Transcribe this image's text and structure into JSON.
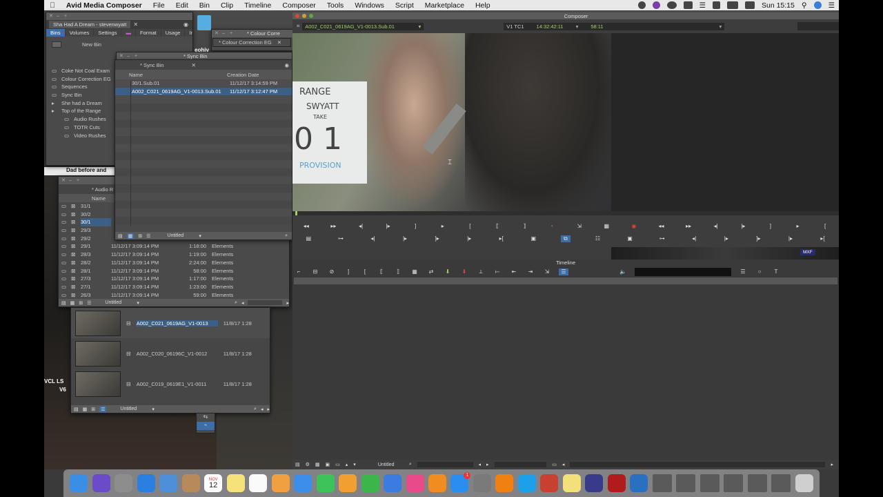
{
  "menubar": {
    "apple": "",
    "app_name": "Avid Media Composer",
    "items": [
      "File",
      "Edit",
      "Bin",
      "Clip",
      "Timeline",
      "Composer",
      "Tools",
      "Windows",
      "Script",
      "Marketplace",
      "Help"
    ],
    "clock": "Sun 15:15"
  },
  "project_window": {
    "title": "Sha Had A Dream - stevenwyatt",
    "tabs": [
      "Bins",
      "Volumes",
      "Settings",
      "Format",
      "Usage",
      "Info"
    ],
    "new_bin": "New Bin",
    "bins": [
      {
        "label": "Coke Not Coal Exam",
        "indent": 0
      },
      {
        "label": "Colour Correction EG",
        "indent": 0
      },
      {
        "label": "Sequences",
        "indent": 0
      },
      {
        "label": "Sync Bin",
        "indent": 0
      },
      {
        "label": "She had a Dream",
        "indent": 0,
        "folder": true
      },
      {
        "label": "Top of the Range",
        "indent": 0,
        "folder": true
      },
      {
        "label": "Audio Rushes",
        "indent": 1
      },
      {
        "label": "TOTR Cuts",
        "indent": 1
      },
      {
        "label": "Video Rushes",
        "indent": 1
      }
    ]
  },
  "colour_correction_tab": "* Colour Correction EG",
  "colour_corre_back": "* Colour Corre",
  "sync_bin": {
    "title": "* Sync Bin",
    "back_title": "* Sync Bin",
    "headers": [
      "Name",
      "Creation Date"
    ],
    "rows": [
      {
        "name": "30/1.Sub.01",
        "date": "11/12/17 3:14:59 PM",
        "selected": false
      },
      {
        "name": "A002_C021_0619AG_V1-0013.Sub.01",
        "date": "11/12/17 3:12:47 PM",
        "selected": true
      }
    ],
    "view": "Untitled"
  },
  "audio_bin": {
    "title": "* Audio R",
    "header": "Name",
    "rows": [
      {
        "name": "31/1",
        "date": "",
        "dur": "",
        "tracks": "",
        "selected": false
      },
      {
        "name": "30/2",
        "date": "",
        "dur": "",
        "tracks": "",
        "selected": false
      },
      {
        "name": "30/1",
        "date": "",
        "dur": "",
        "tracks": "",
        "selected": true
      },
      {
        "name": "29/3",
        "date": "",
        "dur": "",
        "tracks": "",
        "selected": false
      },
      {
        "name": "29/2",
        "date": "",
        "dur": "",
        "tracks": "",
        "selected": false
      },
      {
        "name": "29/1",
        "date": "11/12/17 3:09:14 PM",
        "dur": "1:18:00",
        "tracks": "Elements",
        "selected": false
      },
      {
        "name": "28/3",
        "date": "11/12/17 3:09:14 PM",
        "dur": "1:19:00",
        "tracks": "Elements",
        "selected": false
      },
      {
        "name": "28/2",
        "date": "11/12/17 3:09:14 PM",
        "dur": "2:24:00",
        "tracks": "Elements",
        "selected": false
      },
      {
        "name": "28/1",
        "date": "11/12/17 3:09:14 PM",
        "dur": "58:00",
        "tracks": "Elements",
        "selected": false
      },
      {
        "name": "27/3",
        "date": "11/12/17 3:09:14 PM",
        "dur": "1:17:00",
        "tracks": "Elements",
        "selected": false
      },
      {
        "name": "27/1",
        "date": "11/12/17 3:09:14 PM",
        "dur": "1:23:00",
        "tracks": "Elements",
        "selected": false
      },
      {
        "name": "26/3",
        "date": "11/12/17 3:09:14 PM",
        "dur": "59:00",
        "tracks": "Elements",
        "selected": false
      }
    ],
    "view": "Untitled"
  },
  "behind_window_title": "Dad before and",
  "behind_window_text_2": "eohiv",
  "video_bin": {
    "items": [
      {
        "name": "A002_C021_0619AG_V1-0013",
        "date": "11/8/17 1:28"
      },
      {
        "name": "A002_C020_06196C_V1-0012",
        "date": "11/8/17 1:28"
      },
      {
        "name": "A002_C019_0619E1_V1-0011",
        "date": "11/8/17 1:28"
      }
    ],
    "view": "Untitled"
  },
  "vcl_text": "VCL LS",
  "v6_text": "V6",
  "composer": {
    "title": "Composer",
    "clip_name": "A002_C021_0619AG_V1-0013.Sub.01",
    "tc_label": "V1  TC1",
    "timecode": "14:32:42:11",
    "duration": "58:11",
    "slate_lines": [
      "RANGE",
      "SWYATT",
      "TAKE",
      "0  1",
      "PROVISION"
    ]
  },
  "timeline": {
    "title": "Timeline",
    "view": "Untitled"
  },
  "mxf_badge": "MXF",
  "dock": {
    "calendar_month": "NOV",
    "calendar_day": "12",
    "badge_appstore": "1",
    "icons": [
      "finder-icon",
      "siri-icon",
      "launchpad-icon",
      "safari-icon",
      "preview-icon",
      "contacts-icon",
      "calendar-icon",
      "notes-icon",
      "reminders-icon",
      "photos-icon",
      "mail-icon",
      "messages-icon",
      "pages-icon",
      "numbers-icon",
      "keynote-icon",
      "itunes-icon",
      "ibooks-icon",
      "appstore-icon",
      "system-preferences-icon",
      "vlc-icon",
      "skype-icon",
      "fruit-icon",
      "stickies-icon",
      "media-composer-icon",
      "acrobat-icon",
      "quicktime-icon",
      "window-thumb-icon",
      "window-thumb-icon",
      "window-thumb-icon",
      "window-thumb-icon",
      "window-thumb-icon",
      "window-thumb-icon",
      "trash-icon"
    ]
  },
  "colors": {
    "selection": "#3c5f86",
    "menubar": "#e8e8e8",
    "timecode_green": "#9fd36a"
  }
}
